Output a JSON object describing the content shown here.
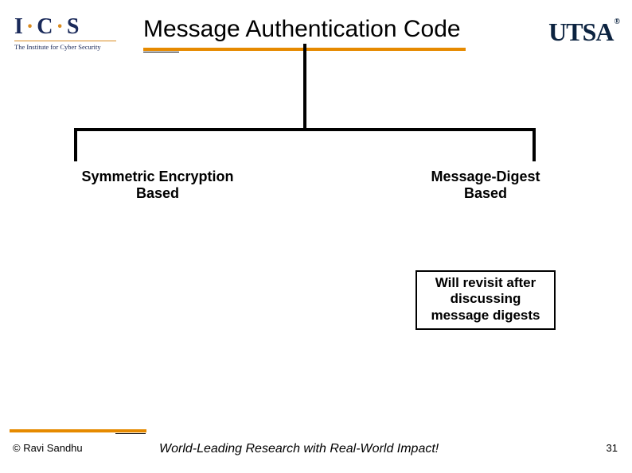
{
  "logoLeft": {
    "letters": "I·C·S",
    "subtitle": "The Institute for Cyber Security"
  },
  "logoRight": "UTSA",
  "title": "Message Authentication Code",
  "branches": {
    "left": {
      "line1": "Symmetric Encryption",
      "line2": "Based"
    },
    "right": {
      "line1": "Message-Digest",
      "line2": "Based"
    }
  },
  "note": {
    "line1": "Will revisit after",
    "line2": "discussing",
    "line3": "message digests"
  },
  "footer": {
    "copyright": "© Ravi  Sandhu",
    "tagline": "World-Leading Research with Real-World Impact!",
    "page": "31"
  }
}
